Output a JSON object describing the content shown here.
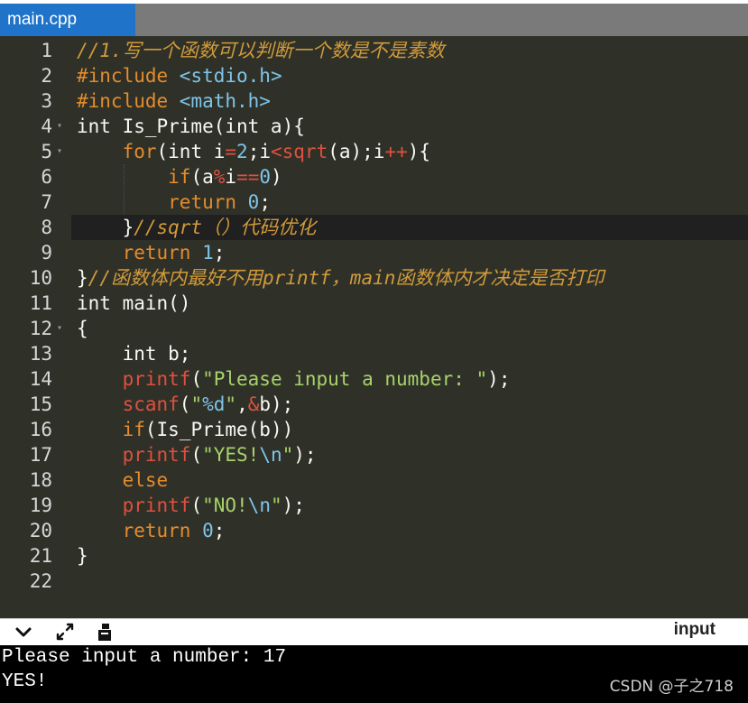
{
  "tab": {
    "title": "main.cpp"
  },
  "editor": {
    "lines": [
      {
        "num": "1",
        "fold": "",
        "tokens": [
          {
            "t": "//1.写一个函数可以判断一个数是不是素数",
            "c": "cmt"
          }
        ]
      },
      {
        "num": "2",
        "fold": "",
        "tokens": [
          {
            "t": "#include ",
            "c": "pre"
          },
          {
            "t": "<stdio.h>",
            "c": "hdr"
          }
        ]
      },
      {
        "num": "3",
        "fold": "",
        "tokens": [
          {
            "t": "#include ",
            "c": "pre"
          },
          {
            "t": "<math.h>",
            "c": "hdr"
          }
        ]
      },
      {
        "num": "4",
        "fold": "▾",
        "tokens": [
          {
            "t": "int Is_Prime(int a){",
            "c": ""
          }
        ]
      },
      {
        "num": "5",
        "fold": "▾",
        "tokens": [
          {
            "t": "    ",
            "c": ""
          },
          {
            "t": "for",
            "c": "kw"
          },
          {
            "t": "(int i",
            "c": ""
          },
          {
            "t": "=",
            "c": "op"
          },
          {
            "t": "2",
            "c": "num"
          },
          {
            "t": ";i",
            "c": ""
          },
          {
            "t": "<",
            "c": "op"
          },
          {
            "t": "sqrt",
            "c": "fn"
          },
          {
            "t": "(a);i",
            "c": ""
          },
          {
            "t": "++",
            "c": "op"
          },
          {
            "t": "){",
            "c": ""
          }
        ]
      },
      {
        "num": "6",
        "fold": "",
        "tokens": [
          {
            "t": "        ",
            "c": ""
          },
          {
            "t": "if",
            "c": "kw"
          },
          {
            "t": "(a",
            "c": ""
          },
          {
            "t": "%",
            "c": "op"
          },
          {
            "t": "i",
            "c": ""
          },
          {
            "t": "==",
            "c": "op"
          },
          {
            "t": "0",
            "c": "num"
          },
          {
            "t": ")",
            "c": ""
          }
        ]
      },
      {
        "num": "7",
        "fold": "",
        "tokens": [
          {
            "t": "        ",
            "c": ""
          },
          {
            "t": "return",
            "c": "kw"
          },
          {
            "t": " ",
            "c": ""
          },
          {
            "t": "0",
            "c": "num"
          },
          {
            "t": ";",
            "c": ""
          }
        ]
      },
      {
        "num": "8",
        "fold": "",
        "tokens": [
          {
            "t": "    }",
            "c": ""
          },
          {
            "t": "//sqrt（）代码优化",
            "c": "cmt"
          }
        ]
      },
      {
        "num": "9",
        "fold": "",
        "tokens": [
          {
            "t": "    ",
            "c": ""
          },
          {
            "t": "return",
            "c": "kw"
          },
          {
            "t": " ",
            "c": ""
          },
          {
            "t": "1",
            "c": "num"
          },
          {
            "t": ";",
            "c": ""
          }
        ]
      },
      {
        "num": "10",
        "fold": "",
        "tokens": [
          {
            "t": "}",
            "c": ""
          },
          {
            "t": "//函数体内最好不用printf，main函数体内才决定是否打印",
            "c": "cmt"
          }
        ]
      },
      {
        "num": "11",
        "fold": "",
        "tokens": [
          {
            "t": "int main()",
            "c": ""
          }
        ]
      },
      {
        "num": "12",
        "fold": "▾",
        "tokens": [
          {
            "t": "{",
            "c": ""
          }
        ]
      },
      {
        "num": "13",
        "fold": "",
        "tokens": [
          {
            "t": "    int b;",
            "c": ""
          }
        ]
      },
      {
        "num": "14",
        "fold": "",
        "tokens": [
          {
            "t": "    ",
            "c": ""
          },
          {
            "t": "printf",
            "c": "fn"
          },
          {
            "t": "(",
            "c": ""
          },
          {
            "t": "\"Please input a number: \"",
            "c": "str"
          },
          {
            "t": ");",
            "c": ""
          }
        ]
      },
      {
        "num": "15",
        "fold": "",
        "tokens": [
          {
            "t": "    ",
            "c": ""
          },
          {
            "t": "scanf",
            "c": "fn"
          },
          {
            "t": "(",
            "c": ""
          },
          {
            "t": "\"",
            "c": "str"
          },
          {
            "t": "%d",
            "c": "esc"
          },
          {
            "t": "\"",
            "c": "str"
          },
          {
            "t": ",",
            "c": ""
          },
          {
            "t": "&",
            "c": "op"
          },
          {
            "t": "b);",
            "c": ""
          }
        ]
      },
      {
        "num": "16",
        "fold": "",
        "tokens": [
          {
            "t": "    ",
            "c": ""
          },
          {
            "t": "if",
            "c": "kw"
          },
          {
            "t": "(Is_Prime(b))",
            "c": ""
          }
        ]
      },
      {
        "num": "17",
        "fold": "",
        "tokens": [
          {
            "t": "    ",
            "c": ""
          },
          {
            "t": "printf",
            "c": "fn"
          },
          {
            "t": "(",
            "c": ""
          },
          {
            "t": "\"YES!",
            "c": "str"
          },
          {
            "t": "\\n",
            "c": "esc"
          },
          {
            "t": "\"",
            "c": "str"
          },
          {
            "t": ");",
            "c": ""
          }
        ]
      },
      {
        "num": "18",
        "fold": "",
        "tokens": [
          {
            "t": "    ",
            "c": ""
          },
          {
            "t": "else",
            "c": "kw"
          }
        ]
      },
      {
        "num": "19",
        "fold": "",
        "tokens": [
          {
            "t": "    ",
            "c": ""
          },
          {
            "t": "printf",
            "c": "fn"
          },
          {
            "t": "(",
            "c": ""
          },
          {
            "t": "\"NO!",
            "c": "str"
          },
          {
            "t": "\\n",
            "c": "esc"
          },
          {
            "t": "\"",
            "c": "str"
          },
          {
            "t": ");",
            "c": ""
          }
        ]
      },
      {
        "num": "20",
        "fold": "",
        "tokens": [
          {
            "t": "    ",
            "c": ""
          },
          {
            "t": "return",
            "c": "kw"
          },
          {
            "t": " ",
            "c": ""
          },
          {
            "t": "0",
            "c": "num"
          },
          {
            "t": ";",
            "c": ""
          }
        ]
      },
      {
        "num": "21",
        "fold": "",
        "tokens": [
          {
            "t": "}",
            "c": ""
          }
        ]
      },
      {
        "num": "22",
        "fold": "",
        "tokens": []
      }
    ],
    "highlighted_line": "8"
  },
  "toolbar": {
    "icons": [
      "chevron-down-icon",
      "expand-icon",
      "clear-console-icon"
    ],
    "input_label": "input"
  },
  "console": {
    "lines": [
      "Please input a number: 17",
      "YES!"
    ]
  },
  "watermark": "CSDN @子之718",
  "colors": {
    "tab_active": "#1f73c9",
    "editor_bg": "#2f3129",
    "comment": "#d19a3a",
    "keyword": "#e38c2d",
    "function": "#e0503f",
    "number": "#7fc4e8",
    "string": "#a8d26a",
    "console_bg": "#000000"
  }
}
